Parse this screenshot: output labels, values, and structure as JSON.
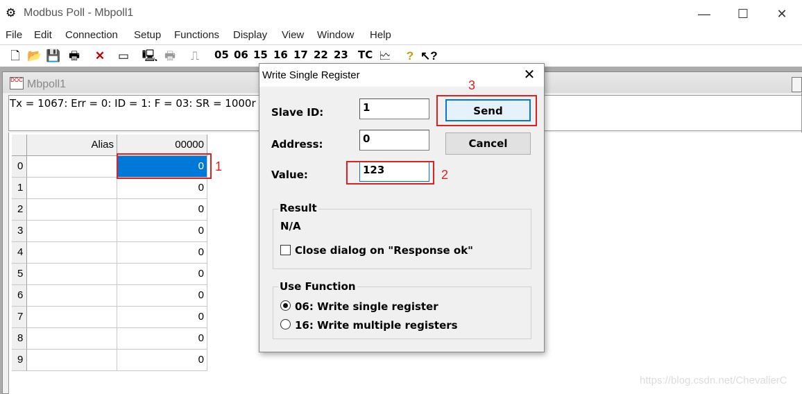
{
  "window": {
    "title": "Modbus Poll - Mbpoll1",
    "minimize": "—",
    "maximize": "☐",
    "close": "✕"
  },
  "menu": [
    "File",
    "Edit",
    "Connection",
    "Setup",
    "Functions",
    "Display",
    "View",
    "Window",
    "Help"
  ],
  "toolbar": {
    "function_codes": [
      "05",
      "06",
      "15",
      "16",
      "17",
      "22",
      "23"
    ],
    "tc_label": "TC"
  },
  "child_window": {
    "title": "Mbpoll1",
    "status": "Tx = 1067: Err = 0: ID = 1: F = 03: SR = 1000r"
  },
  "grid": {
    "alias_header": "Alias",
    "address_header": "00000",
    "rows": [
      {
        "num": "0",
        "value": "0"
      },
      {
        "num": "1",
        "value": "0"
      },
      {
        "num": "2",
        "value": "0"
      },
      {
        "num": "3",
        "value": "0"
      },
      {
        "num": "4",
        "value": "0"
      },
      {
        "num": "5",
        "value": "0"
      },
      {
        "num": "6",
        "value": "0"
      },
      {
        "num": "7",
        "value": "0"
      },
      {
        "num": "8",
        "value": "0"
      },
      {
        "num": "9",
        "value": "0"
      }
    ],
    "selected_row": 0
  },
  "dialog": {
    "title": "Write Single Register",
    "slave_id_label": "Slave ID:",
    "slave_id_value": "1",
    "address_label": "Address:",
    "address_value": "0",
    "value_label": "Value:",
    "value_value": "123",
    "send_label": "Send",
    "cancel_label": "Cancel",
    "result_group_label": "Result",
    "result_text": "N/A",
    "close_on_ok_label": "Close dialog on \"Response ok\"",
    "close_on_ok_checked": false,
    "use_function_label": "Use Function",
    "function_options": [
      "06: Write single register",
      "16: Write multiple registers"
    ],
    "selected_function": 0
  },
  "annotations": [
    "1",
    "2",
    "3"
  ],
  "watermark": "https://blog.csdn.net/ChevalierC",
  "colors": {
    "selection": "#0078d7",
    "annotation": "#e02020"
  }
}
